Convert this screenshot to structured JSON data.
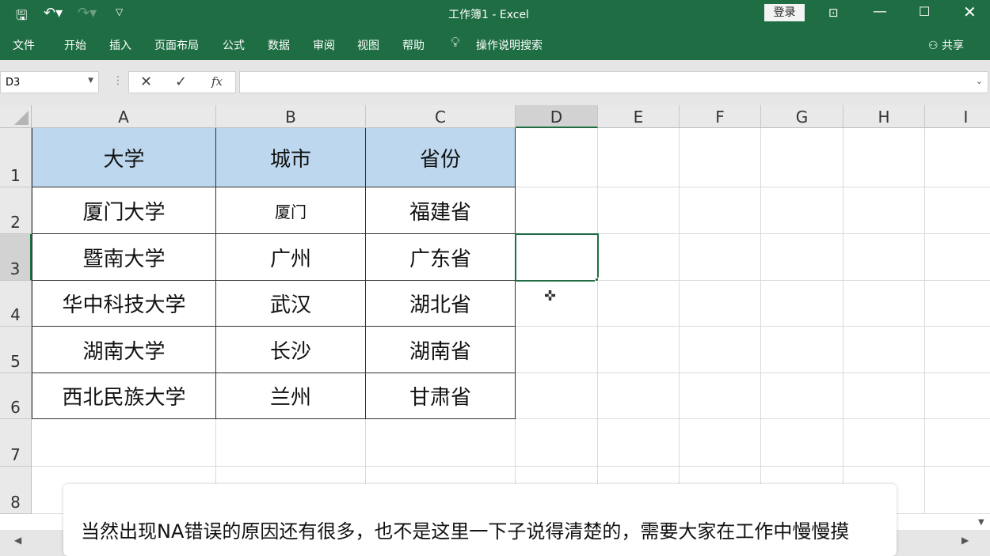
{
  "titlebar": {
    "title": "工作簿1  -  Excel",
    "login": "登录"
  },
  "ribbon": {
    "tabs": [
      "文件",
      "开始",
      "插入",
      "页面布局",
      "公式",
      "数据",
      "审阅",
      "视图",
      "帮助"
    ],
    "tell_me": "操作说明搜索",
    "share": "共享"
  },
  "formula_bar": {
    "name_box": "D3",
    "formula": "",
    "fx": "fx"
  },
  "columns": [
    "A",
    "B",
    "C",
    "D",
    "E",
    "F",
    "G",
    "H",
    "I"
  ],
  "rows": [
    "1",
    "2",
    "3",
    "4",
    "5",
    "6",
    "7",
    "8"
  ],
  "table": {
    "headers": [
      "大学",
      "城市",
      "省份"
    ],
    "data": [
      [
        "厦门大学",
        "厦门",
        "福建省"
      ],
      [
        "暨南大学",
        "广州",
        "广东省"
      ],
      [
        "华中科技大学",
        "武汉",
        "湖北省"
      ],
      [
        "湖南大学",
        "长沙",
        "湖南省"
      ],
      [
        "西北民族大学",
        "兰州",
        "甘肃省"
      ]
    ]
  },
  "selected_cell": "D3",
  "subtitle": "当然出现NA错误的原因还有很多，也不是这里一下子说得清楚的，需要大家在工作中慢慢摸",
  "colors": {
    "accent": "#1f6e43",
    "header_fill": "#bdd7ee"
  }
}
